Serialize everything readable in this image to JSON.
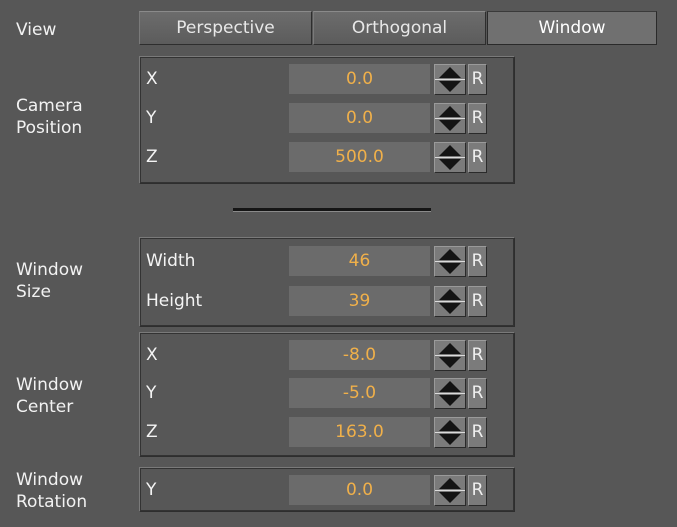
{
  "view": {
    "label": "View",
    "options": [
      "Perspective",
      "Orthogonal",
      "Window"
    ],
    "selected": "Window"
  },
  "camera_position": {
    "label": "Camera\nPosition",
    "rows": [
      {
        "axis": "X",
        "value": "0.0"
      },
      {
        "axis": "Y",
        "value": "0.0"
      },
      {
        "axis": "Z",
        "value": "500.0"
      }
    ]
  },
  "window_size": {
    "label": "Window\nSize",
    "rows": [
      {
        "axis": "Width",
        "value": "46"
      },
      {
        "axis": "Height",
        "value": "39"
      }
    ]
  },
  "window_center": {
    "label": "Window\nCenter",
    "rows": [
      {
        "axis": "X",
        "value": "-8.0"
      },
      {
        "axis": "Y",
        "value": "-5.0"
      },
      {
        "axis": "Z",
        "value": "163.0"
      }
    ]
  },
  "window_rotation": {
    "label": "Window\nRotation",
    "rows": [
      {
        "axis": "Y",
        "value": "0.0"
      }
    ]
  },
  "reset_label": "R",
  "icons": {
    "spinner": "up-down-spinner-icon"
  },
  "colors": {
    "background": "#575757",
    "value_text": "#f0b04a",
    "value_field": "#6b6b6b"
  }
}
